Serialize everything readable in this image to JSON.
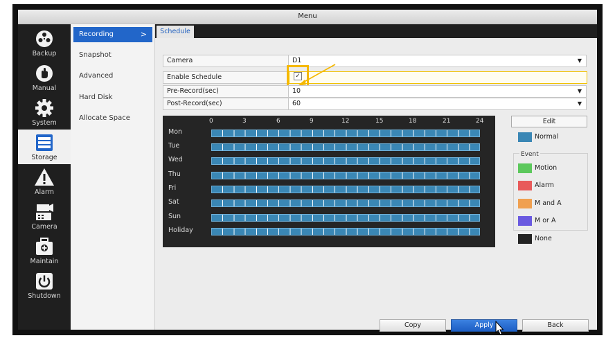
{
  "window": {
    "title": "Menu"
  },
  "sidebar": {
    "items": [
      {
        "label": "Backup",
        "icon": "film-reel-icon",
        "active": false
      },
      {
        "label": "Manual",
        "icon": "hand-icon",
        "active": false
      },
      {
        "label": "System",
        "icon": "gear-icon",
        "active": false
      },
      {
        "label": "Storage",
        "icon": "storage-icon",
        "active": true
      },
      {
        "label": "Alarm",
        "icon": "warning-icon",
        "active": false
      },
      {
        "label": "Camera",
        "icon": "camera-icon",
        "active": false
      },
      {
        "label": "Maintain",
        "icon": "toolbox-icon",
        "active": false
      },
      {
        "label": "Shutdown",
        "icon": "power-icon",
        "active": false
      }
    ]
  },
  "submenu": {
    "items": [
      {
        "label": "Recording",
        "active": true,
        "arrow": ">"
      },
      {
        "label": "Snapshot",
        "active": false
      },
      {
        "label": "Advanced",
        "active": false
      },
      {
        "label": "Hard Disk",
        "active": false
      },
      {
        "label": "Allocate Space",
        "active": false
      }
    ]
  },
  "tabs": [
    {
      "label": "Schedule",
      "active": true
    }
  ],
  "form": {
    "camera": {
      "label": "Camera",
      "value": "D1"
    },
    "enable_schedule": {
      "label": "Enable Schedule",
      "checked": true,
      "check_glyph": "✓"
    },
    "pre_record": {
      "label": "Pre-Record(sec)",
      "value": "10"
    },
    "post_record": {
      "label": "Post-Record(sec)",
      "value": "60"
    }
  },
  "schedule": {
    "hours": [
      "0",
      "3",
      "6",
      "9",
      "12",
      "15",
      "18",
      "21",
      "24"
    ],
    "days": [
      "Mon",
      "Tue",
      "Wed",
      "Thu",
      "Fri",
      "Sat",
      "Sun",
      "Holiday"
    ],
    "fill_mode": "Normal",
    "fill_color": "#3a87b5"
  },
  "legend": {
    "edit_label": "Edit",
    "normal": {
      "label": "Normal",
      "color": "#3a87b5"
    },
    "event_title": "Event",
    "motion": {
      "label": "Motion",
      "color": "#5cc85c"
    },
    "alarm": {
      "label": "Alarm",
      "color": "#e85a5a"
    },
    "m_and_a": {
      "label": "M and A",
      "color": "#f0a050"
    },
    "m_or_a": {
      "label": "M or A",
      "color": "#6a5ae0"
    },
    "none": {
      "label": "None",
      "color": "#222222"
    }
  },
  "buttons": {
    "copy": "Copy",
    "apply": "Apply",
    "back": "Back"
  },
  "colors": {
    "accent": "#2266c9",
    "highlight": "#f5b800"
  }
}
